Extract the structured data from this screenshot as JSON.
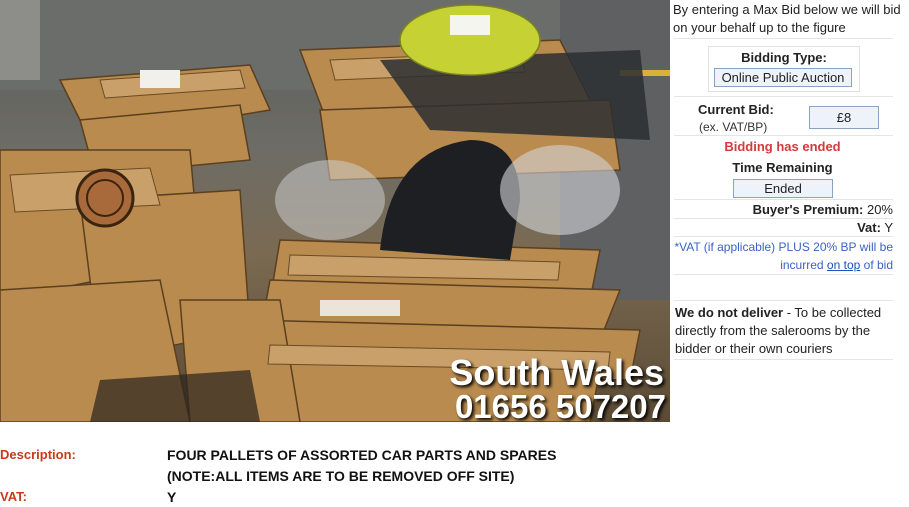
{
  "photo": {
    "watermark_region": "South Wales",
    "watermark_phone": "01656 507207"
  },
  "panel": {
    "max_bid_info": "By entering a Max Bid below we will bid on your behalf up to the figure",
    "bidding_type_label": "Bidding Type:",
    "bidding_type_value": "Online Public Auction",
    "current_bid_label": "Current Bid:",
    "current_bid_sub": "(ex. VAT/BP)",
    "current_bid_value": "£8",
    "bidding_status": "Bidding has ended",
    "time_remaining_label": "Time Remaining",
    "time_remaining_value": "Ended",
    "buyers_premium_label": "Buyer's Premium:",
    "buyers_premium_value": "20%",
    "vat_label": "Vat:",
    "vat_value": "Y",
    "vat_note_pre": "*VAT (if applicable) PLUS 20% BP will be incurred",
    "vat_note_link": "on top",
    "vat_note_post": "of bid",
    "delivery_bold": "We do not deliver",
    "delivery_text": " - To be collected directly from the salerooms by the bidder or their own couriers"
  },
  "details": {
    "description_label": "Description:",
    "description_line1": "FOUR PALLETS OF ASSORTED CAR PARTS AND SPARES",
    "description_line2": "(NOTE:ALL ITEMS ARE TO BE REMOVED OFF SITE)",
    "vat_label": "VAT:",
    "vat_value": "Y"
  }
}
